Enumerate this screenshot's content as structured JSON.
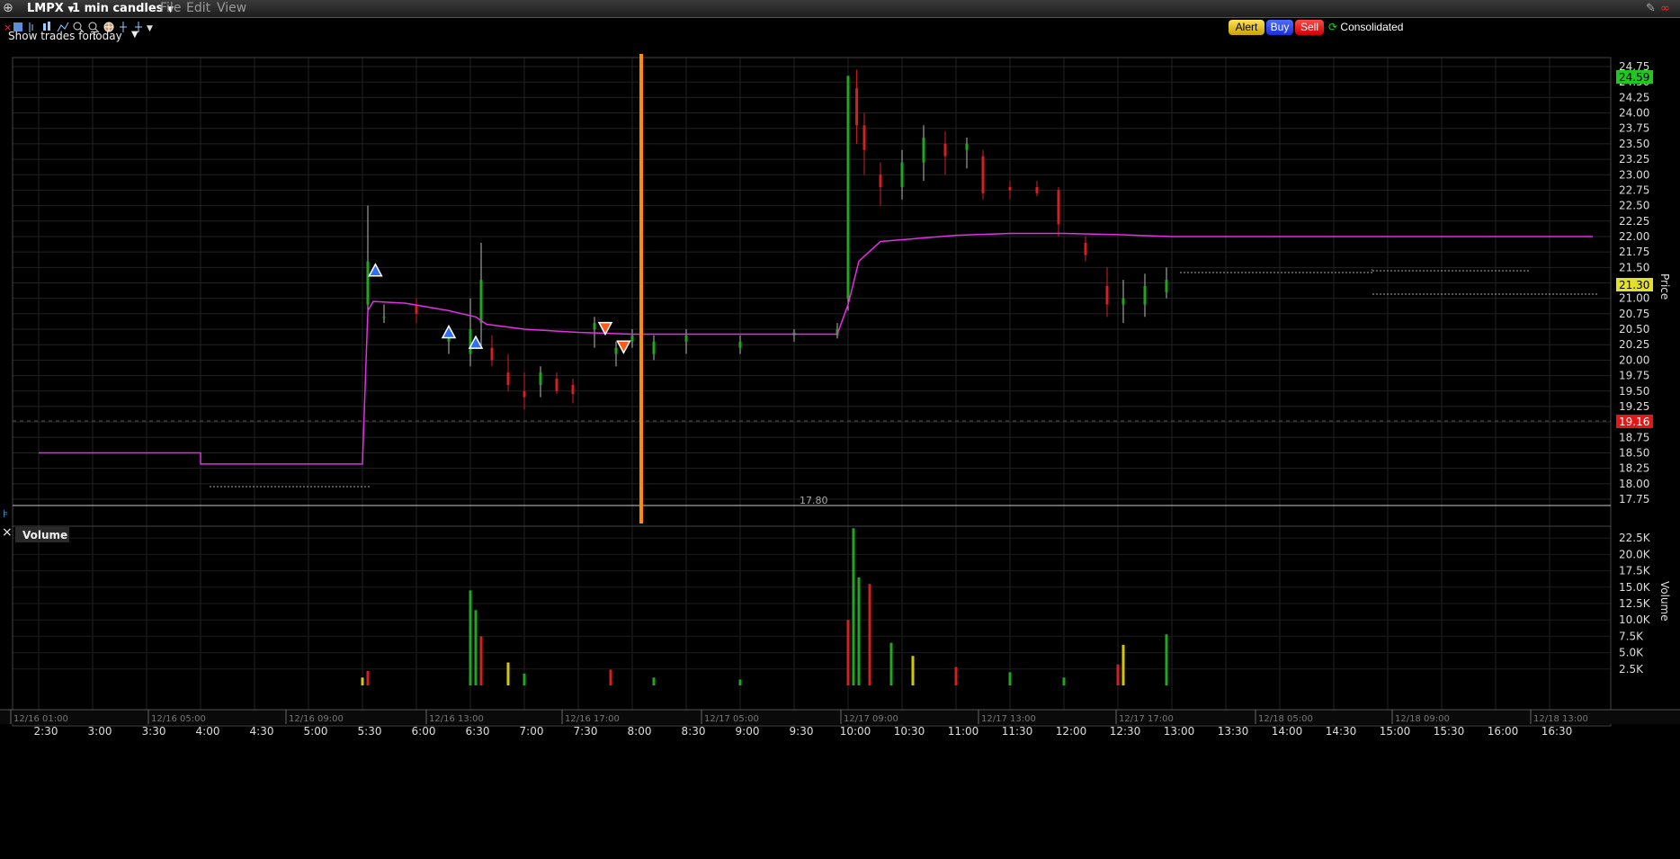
{
  "titlebar": {
    "symbol": "LMPX",
    "interval": "1 min candles",
    "menus": [
      "File",
      "Edit",
      "View"
    ]
  },
  "actions": {
    "alert": "Alert",
    "buy": "Buy",
    "sell": "Sell",
    "consolidated": "Consolidated"
  },
  "show_trades": {
    "label": "Show trades for:",
    "value": "Today"
  },
  "price_panel": {
    "axis_title": "Price",
    "last_price_tag": "24.59",
    "bid_ask_tag": "21.30",
    "red_price_tag": "19.16",
    "low_annotation": "17.80"
  },
  "volume_panel": {
    "title": "Volume",
    "axis_title": "Volume"
  },
  "colors": {
    "vwap": "#e62ee6",
    "cursor": "#ff8c00",
    "up": "#1fa81f",
    "down": "#d42020",
    "buy_marker": "#2f6ff5",
    "sell_marker": "#ff5a1a"
  },
  "chart_data": {
    "type": "candlestick",
    "price_axis": {
      "ylim": [
        17.75,
        24.75
      ],
      "ticks": [
        "24.75",
        "24.50",
        "24.25",
        "24.00",
        "23.75",
        "23.50",
        "23.25",
        "23.00",
        "22.75",
        "22.50",
        "22.25",
        "22.00",
        "21.75",
        "21.50",
        "21.25",
        "21.00",
        "20.75",
        "20.50",
        "20.25",
        "20.00",
        "19.75",
        "19.50",
        "19.25",
        "19.00",
        "18.75",
        "18.50",
        "18.25",
        "18.00",
        "17.75"
      ]
    },
    "volume_axis": {
      "ylim": [
        0,
        25000
      ],
      "ticks": [
        "22.5K",
        "20.0K",
        "17.5K",
        "15.0K",
        "12.5K",
        "10.0K",
        "7.5K",
        "5.0K",
        "2.5K"
      ]
    },
    "time_axis": [
      "2:30",
      "3:00",
      "3:30",
      "4:00",
      "4:30",
      "5:00",
      "5:30",
      "6:00",
      "6:30",
      "7:00",
      "7:30",
      "8:00",
      "8:30",
      "9:00",
      "9:30",
      "10:00",
      "10:30",
      "11:00",
      "11:30",
      "12:00",
      "12:30",
      "13:00",
      "13:30",
      "14:00",
      "14:30",
      "15:00",
      "15:30",
      "16:00",
      "16:30"
    ],
    "date_axis": [
      "12/16 01:00",
      "12/16 05:00",
      "12/16 09:00",
      "12/16 13:00",
      "12/16 17:00",
      "12/17 05:00",
      "12/17 09:00",
      "12/17 13:00",
      "12/17 17:00",
      "12/18 05:00",
      "12/18 09:00",
      "12/18 13:00"
    ],
    "vwap": [
      [
        2.5,
        18.5
      ],
      [
        4.0,
        18.5
      ],
      [
        4.0,
        18.32
      ],
      [
        5.5,
        18.32
      ],
      [
        5.55,
        20.8
      ],
      [
        5.6,
        20.95
      ],
      [
        5.9,
        20.92
      ],
      [
        6.3,
        20.8
      ],
      [
        6.55,
        20.7
      ],
      [
        6.65,
        20.58
      ],
      [
        7.0,
        20.5
      ],
      [
        7.5,
        20.45
      ],
      [
        8.0,
        20.42
      ],
      [
        9.0,
        20.42
      ],
      [
        9.9,
        20.42
      ],
      [
        10.0,
        20.9
      ],
      [
        10.1,
        21.6
      ],
      [
        10.3,
        21.92
      ],
      [
        11.0,
        22.02
      ],
      [
        11.5,
        22.05
      ],
      [
        12.0,
        22.05
      ],
      [
        12.5,
        22.03
      ],
      [
        13.0,
        22.0
      ],
      [
        16.9,
        22.0
      ]
    ],
    "candles": [
      [
        5.55,
        20.9,
        22.5,
        20.6,
        21.6
      ],
      [
        5.7,
        20.7,
        20.9,
        20.6,
        20.7
      ],
      [
        6.0,
        20.9,
        21.0,
        20.6,
        20.75
      ],
      [
        6.3,
        20.3,
        20.5,
        20.1,
        20.45
      ],
      [
        6.5,
        20.1,
        21.0,
        19.9,
        20.5
      ],
      [
        6.6,
        20.6,
        21.9,
        20.2,
        21.3
      ],
      [
        6.7,
        20.2,
        20.4,
        19.9,
        20.0
      ],
      [
        6.85,
        19.8,
        20.1,
        19.5,
        19.6
      ],
      [
        7.0,
        19.5,
        19.8,
        19.2,
        19.4
      ],
      [
        7.15,
        19.6,
        19.9,
        19.4,
        19.8
      ],
      [
        7.3,
        19.7,
        19.8,
        19.45,
        19.5
      ],
      [
        7.45,
        19.6,
        19.7,
        19.3,
        19.45
      ],
      [
        7.65,
        20.5,
        20.7,
        20.2,
        20.6
      ],
      [
        7.85,
        20.1,
        20.3,
        19.9,
        20.2
      ],
      [
        8.0,
        20.3,
        20.5,
        20.2,
        20.4
      ],
      [
        8.2,
        20.1,
        20.4,
        20.0,
        20.3
      ],
      [
        8.5,
        20.3,
        20.5,
        20.1,
        20.4
      ],
      [
        9.0,
        20.2,
        20.4,
        20.1,
        20.3
      ],
      [
        9.5,
        20.4,
        20.5,
        20.3,
        20.45
      ],
      [
        9.9,
        20.4,
        20.6,
        20.35,
        20.5
      ],
      [
        10.0,
        21.0,
        24.5,
        20.8,
        24.6
      ],
      [
        10.08,
        24.4,
        24.7,
        23.5,
        23.8
      ],
      [
        10.15,
        23.8,
        24.0,
        23.0,
        23.4
      ],
      [
        10.3,
        23.0,
        23.2,
        22.5,
        22.8
      ],
      [
        10.5,
        22.8,
        23.4,
        22.6,
        23.2
      ],
      [
        10.7,
        23.2,
        23.8,
        22.9,
        23.6
      ],
      [
        10.9,
        23.5,
        23.7,
        23.0,
        23.3
      ],
      [
        11.1,
        23.4,
        23.6,
        23.1,
        23.5
      ],
      [
        11.25,
        23.3,
        23.4,
        22.6,
        22.7
      ],
      [
        11.5,
        22.8,
        22.9,
        22.6,
        22.75
      ],
      [
        11.75,
        22.8,
        22.9,
        22.65,
        22.7
      ],
      [
        11.95,
        22.75,
        22.8,
        22.0,
        22.2
      ],
      [
        12.2,
        21.9,
        22.0,
        21.6,
        21.7
      ],
      [
        12.4,
        21.2,
        21.5,
        20.7,
        20.9
      ],
      [
        12.55,
        20.9,
        21.3,
        20.6,
        21.0
      ],
      [
        12.75,
        20.9,
        21.4,
        20.7,
        21.2
      ],
      [
        12.95,
        21.1,
        21.5,
        21.0,
        21.3
      ]
    ],
    "buy_markers": [
      [
        5.62,
        21.45
      ],
      [
        6.3,
        20.45
      ],
      [
        6.55,
        20.28
      ]
    ],
    "sell_markers": [
      [
        7.75,
        20.52
      ],
      [
        7.92,
        20.22
      ]
    ],
    "volume_bars": [
      [
        5.5,
        1200
      ],
      [
        5.55,
        2200
      ],
      [
        6.5,
        14500
      ],
      [
        6.55,
        11500
      ],
      [
        6.6,
        7500
      ],
      [
        6.85,
        3500
      ],
      [
        7.0,
        1800
      ],
      [
        7.8,
        2400
      ],
      [
        8.2,
        1200
      ],
      [
        9.0,
        900
      ],
      [
        10.0,
        10000
      ],
      [
        10.05,
        24000
      ],
      [
        10.1,
        16500
      ],
      [
        10.2,
        15500
      ],
      [
        10.4,
        6500
      ],
      [
        10.6,
        4500
      ],
      [
        11.0,
        2800
      ],
      [
        11.5,
        2000
      ],
      [
        12.0,
        1200
      ],
      [
        12.5,
        3200
      ],
      [
        12.55,
        6200
      ],
      [
        12.95,
        7800
      ]
    ]
  }
}
